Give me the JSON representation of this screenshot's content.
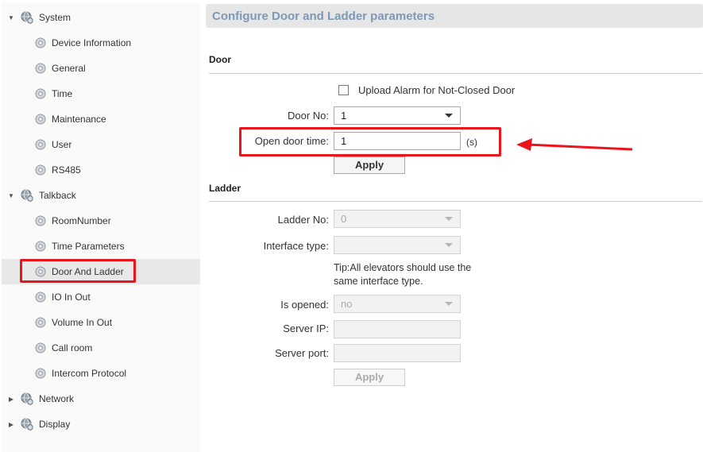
{
  "sidebar": {
    "system": "System",
    "device_information": "Device Information",
    "general": "General",
    "time": "Time",
    "maintenance": "Maintenance",
    "user": "User",
    "rs485": "RS485",
    "talkback": "Talkback",
    "room_number": "RoomNumber",
    "time_parameters": "Time Parameters",
    "door_and_ladder": "Door And Ladder",
    "io_in_out": "IO In Out",
    "volume_in_out": "Volume In Out",
    "call_room": "Call room",
    "intercom_protocol": "Intercom Protocol",
    "network": "Network",
    "display": "Display"
  },
  "main": {
    "title": "Configure Door and Ladder parameters",
    "door": {
      "section": "Door",
      "upload_alarm_label": "Upload Alarm for Not-Closed Door",
      "upload_alarm_checked": false,
      "door_no_label": "Door No:",
      "door_no_value": "1",
      "open_door_time_label": "Open door time:",
      "open_door_time_value": "1",
      "open_door_time_unit": "(s)",
      "apply": "Apply"
    },
    "ladder": {
      "section": "Ladder",
      "ladder_no_label": "Ladder No:",
      "ladder_no_value": "0",
      "interface_type_label": "Interface type:",
      "interface_type_value": "",
      "tip": "Tip:All elevators should use the same interface type.",
      "is_opened_label": "Is opened:",
      "is_opened_value": "no",
      "server_ip_label": "Server IP:",
      "server_ip_value": "",
      "server_port_label": "Server port:",
      "server_port_value": "",
      "apply": "Apply"
    }
  },
  "colors": {
    "highlight": "#e8151d",
    "title_text": "#7e98b8",
    "title_bg": "#e6e6e6"
  }
}
